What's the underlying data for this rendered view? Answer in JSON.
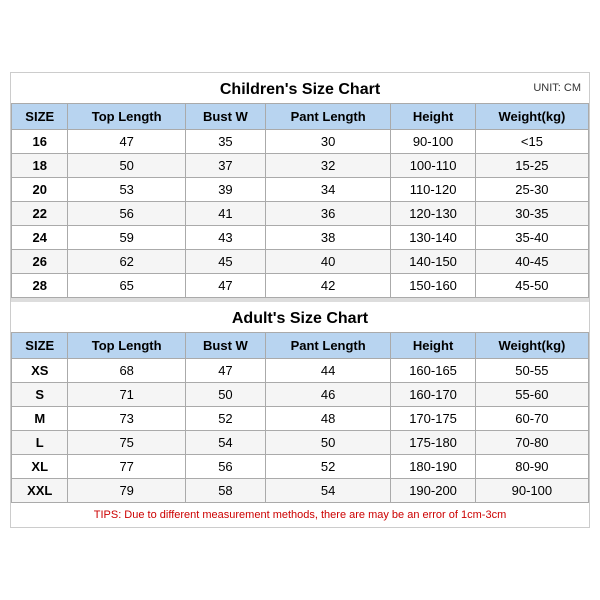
{
  "children_section": {
    "title": "Children's Size Chart",
    "unit": "UNIT: CM",
    "headers": [
      "SIZE",
      "Top Length",
      "Bust W",
      "Pant Length",
      "Height",
      "Weight(kg)"
    ],
    "rows": [
      [
        "16",
        "47",
        "35",
        "30",
        "90-100",
        "<15"
      ],
      [
        "18",
        "50",
        "37",
        "32",
        "100-110",
        "15-25"
      ],
      [
        "20",
        "53",
        "39",
        "34",
        "110-120",
        "25-30"
      ],
      [
        "22",
        "56",
        "41",
        "36",
        "120-130",
        "30-35"
      ],
      [
        "24",
        "59",
        "43",
        "38",
        "130-140",
        "35-40"
      ],
      [
        "26",
        "62",
        "45",
        "40",
        "140-150",
        "40-45"
      ],
      [
        "28",
        "65",
        "47",
        "42",
        "150-160",
        "45-50"
      ]
    ]
  },
  "adult_section": {
    "title": "Adult's Size Chart",
    "headers": [
      "SIZE",
      "Top Length",
      "Bust W",
      "Pant Length",
      "Height",
      "Weight(kg)"
    ],
    "rows": [
      [
        "XS",
        "68",
        "47",
        "44",
        "160-165",
        "50-55"
      ],
      [
        "S",
        "71",
        "50",
        "46",
        "160-170",
        "55-60"
      ],
      [
        "M",
        "73",
        "52",
        "48",
        "170-175",
        "60-70"
      ],
      [
        "L",
        "75",
        "54",
        "50",
        "175-180",
        "70-80"
      ],
      [
        "XL",
        "77",
        "56",
        "52",
        "180-190",
        "80-90"
      ],
      [
        "XXL",
        "79",
        "58",
        "54",
        "190-200",
        "90-100"
      ]
    ]
  },
  "tips": "TIPS: Due to different measurement methods, there are may be an error of 1cm-3cm"
}
